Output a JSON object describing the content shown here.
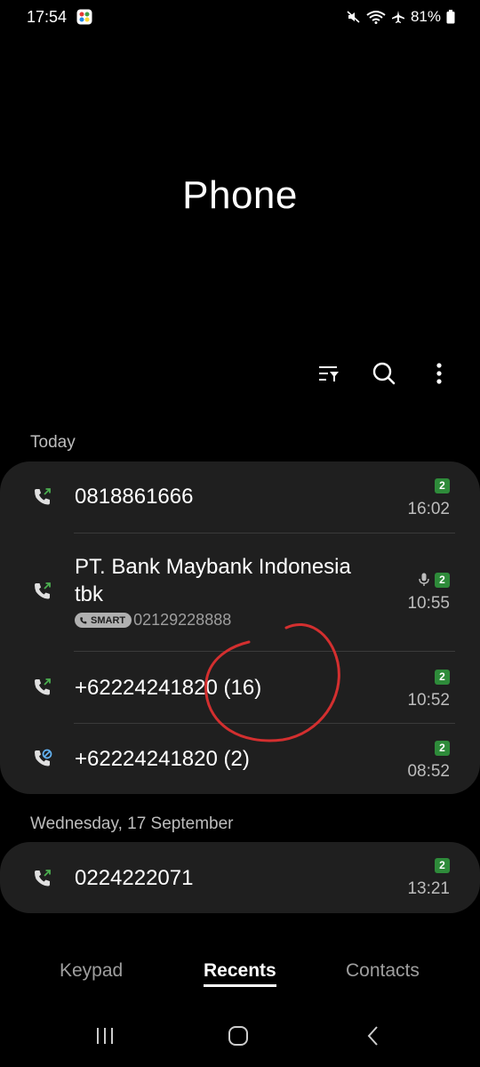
{
  "status_bar": {
    "time": "17:54",
    "battery_percent": "81%",
    "icons": [
      "app-notification-icon",
      "mute-icon",
      "wifi-icon",
      "airplane-icon",
      "battery-icon"
    ]
  },
  "title": "Phone",
  "toolbar": {
    "icons": [
      "filter-icon",
      "search-icon",
      "more-options-icon"
    ]
  },
  "sections": [
    {
      "label": "Today",
      "calls": [
        {
          "name": "0818861666",
          "sim": "2",
          "time": "16:02",
          "type": "outgoing"
        },
        {
          "name": "PT. Bank Maybank Indonesia tbk",
          "name_line1": "PT. Bank Maybank Indonesia",
          "name_line2": "tbk",
          "smart_label": "SMART",
          "number": "02129228888",
          "sim": "2",
          "time": "10:55",
          "type": "outgoing",
          "recorded": true
        },
        {
          "name": "+62224241820 (16)",
          "sim": "2",
          "time": "10:52",
          "type": "outgoing"
        },
        {
          "name": "+62224241820 (2)",
          "sim": "2",
          "time": "08:52",
          "type": "blocked"
        }
      ]
    },
    {
      "label": "Wednesday, 17 September",
      "calls": [
        {
          "name": "0224222071",
          "sim": "2",
          "time": "13:21",
          "type": "outgoing"
        }
      ]
    }
  ],
  "tabs": [
    {
      "label": "Keypad",
      "active": false
    },
    {
      "label": "Recents",
      "active": true
    },
    {
      "label": "Contacts",
      "active": false
    }
  ],
  "nav": [
    "recent-apps-icon",
    "home-icon",
    "back-icon"
  ],
  "colors": {
    "background": "#000000",
    "card": "#1f1f1f",
    "sim_badge": "#2e8b3a",
    "call_arrow": "#4caf50",
    "annotation": "#d32f2f"
  }
}
